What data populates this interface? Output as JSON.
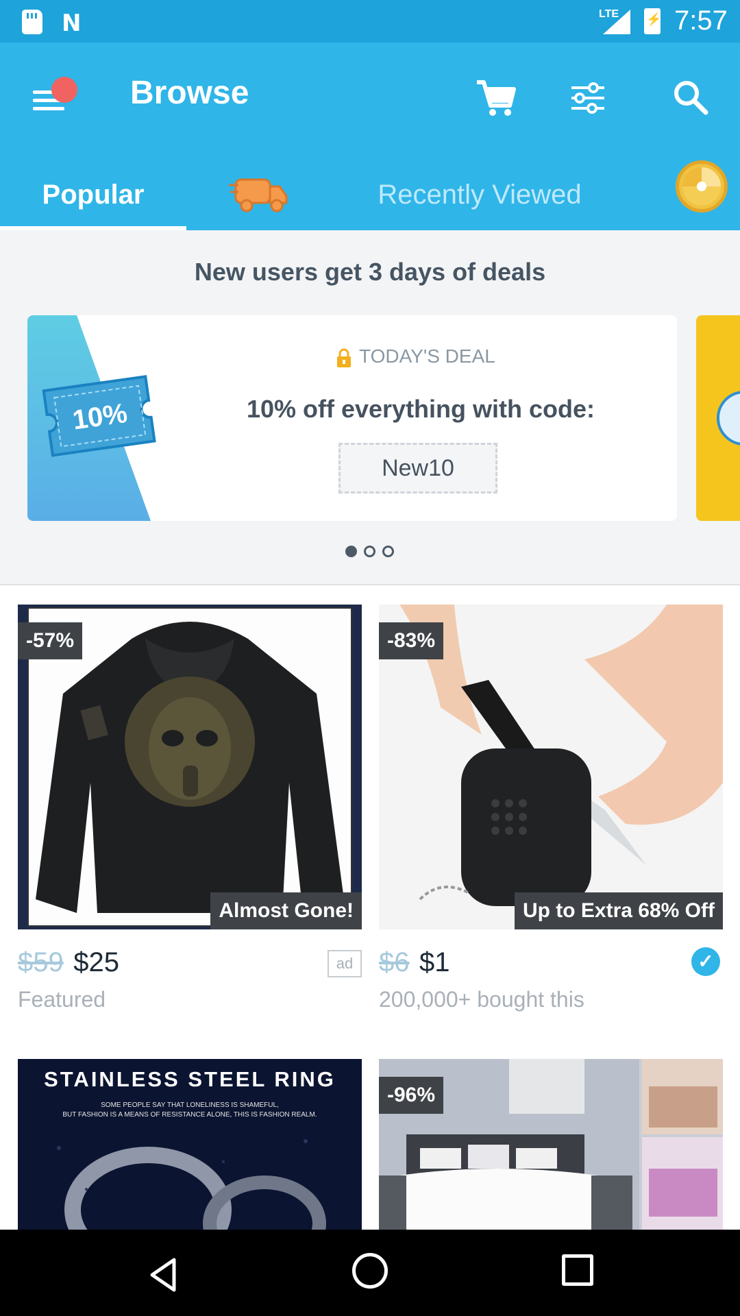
{
  "status_bar": {
    "time": "7:57",
    "network": "LTE"
  },
  "app_bar": {
    "title": "Browse"
  },
  "tabs": [
    {
      "label": "Popular",
      "selected": true
    },
    {
      "label": "Recently Viewed",
      "selected": false
    }
  ],
  "promo": {
    "heading": "New users get 3 days of deals",
    "art_text": "10%",
    "label": "TODAY'S DEAL",
    "main_text": "10% off everything with code:",
    "code": "New10",
    "page_count": 3,
    "active_page": 1
  },
  "products": [
    {
      "discount": "-57%",
      "corner": "Almost Gone!",
      "old_price": "$59",
      "price": "$25",
      "subtext": "Featured",
      "ad": "ad",
      "verified": false
    },
    {
      "discount": "-83%",
      "corner": "Up to Extra 68% Off",
      "old_price": "$6",
      "price": "$1",
      "subtext": "200,000+ bought this",
      "ad": "",
      "verified": true
    },
    {
      "discount": "",
      "corner": "",
      "old_price": "",
      "price": "",
      "subtext": "",
      "image_title": "STAINLESS STEEL RING",
      "image_caption_1": "SOME PEOPLE SAY THAT LONELINESS IS SHAMEFUL,",
      "image_caption_2": "BUT FASHION IS A MEANS OF RESISTANCE ALONE, THIS IS FASHION REALM."
    },
    {
      "discount": "-96%",
      "corner": "",
      "old_price": "",
      "price": "",
      "subtext": ""
    }
  ],
  "colors": {
    "brand": "#2fb5e8",
    "status": "#1ea3da",
    "badge": "#3f4347",
    "notification": "#f06360"
  }
}
